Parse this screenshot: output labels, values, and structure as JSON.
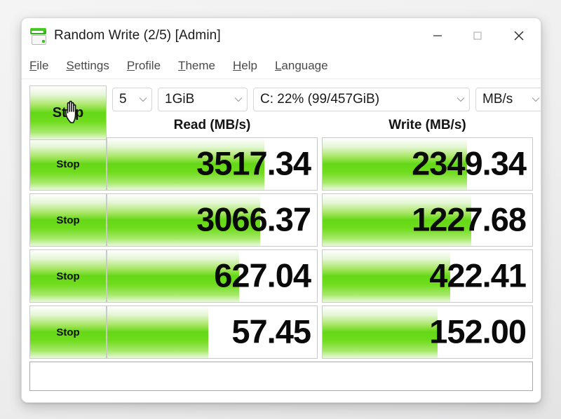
{
  "window": {
    "title": "Random Write (2/5) [Admin]",
    "icon": "crystaldiskmark-icon",
    "controls": {
      "minimize": "minimize-icon",
      "maximize": "maximize-icon",
      "close": "close-icon"
    }
  },
  "menubar": {
    "items": [
      {
        "mnemonic": "F",
        "rest": "ile"
      },
      {
        "mnemonic": "S",
        "rest": "ettings"
      },
      {
        "mnemonic": "P",
        "rest": "rofile"
      },
      {
        "mnemonic": "T",
        "rest": "heme"
      },
      {
        "mnemonic": "H",
        "rest": "elp"
      },
      {
        "mnemonic": "L",
        "rest": "anguage"
      }
    ]
  },
  "toolbar": {
    "all_button_label": "Stop",
    "test_count": "5",
    "test_size": "1GiB",
    "target_drive": "C: 22% (99/457GiB)",
    "unit": "MB/s"
  },
  "headers": {
    "read": "Read (MB/s)",
    "write": "Write (MB/s)"
  },
  "rows": [
    {
      "button_label": "Stop",
      "read_value": "3517.34",
      "write_value": "2349.34",
      "read_fill_pct": 75,
      "write_fill_pct": 69
    },
    {
      "button_label": "Stop",
      "read_value": "3066.37",
      "write_value": "1227.68",
      "read_fill_pct": 73,
      "write_fill_pct": 71
    },
    {
      "button_label": "Stop",
      "read_value": "627.04",
      "write_value": "422.41",
      "read_fill_pct": 63,
      "write_fill_pct": 61
    },
    {
      "button_label": "Stop",
      "read_value": "57.45",
      "write_value": "152.00",
      "read_fill_pct": 48,
      "write_fill_pct": 55
    }
  ],
  "comment": {
    "value": "",
    "placeholder": ""
  },
  "colors": {
    "accent_green": "#63d816",
    "window_bg": "#ffffff",
    "desktop_bg": "#eeeeee",
    "text": "#1a1a1a"
  }
}
